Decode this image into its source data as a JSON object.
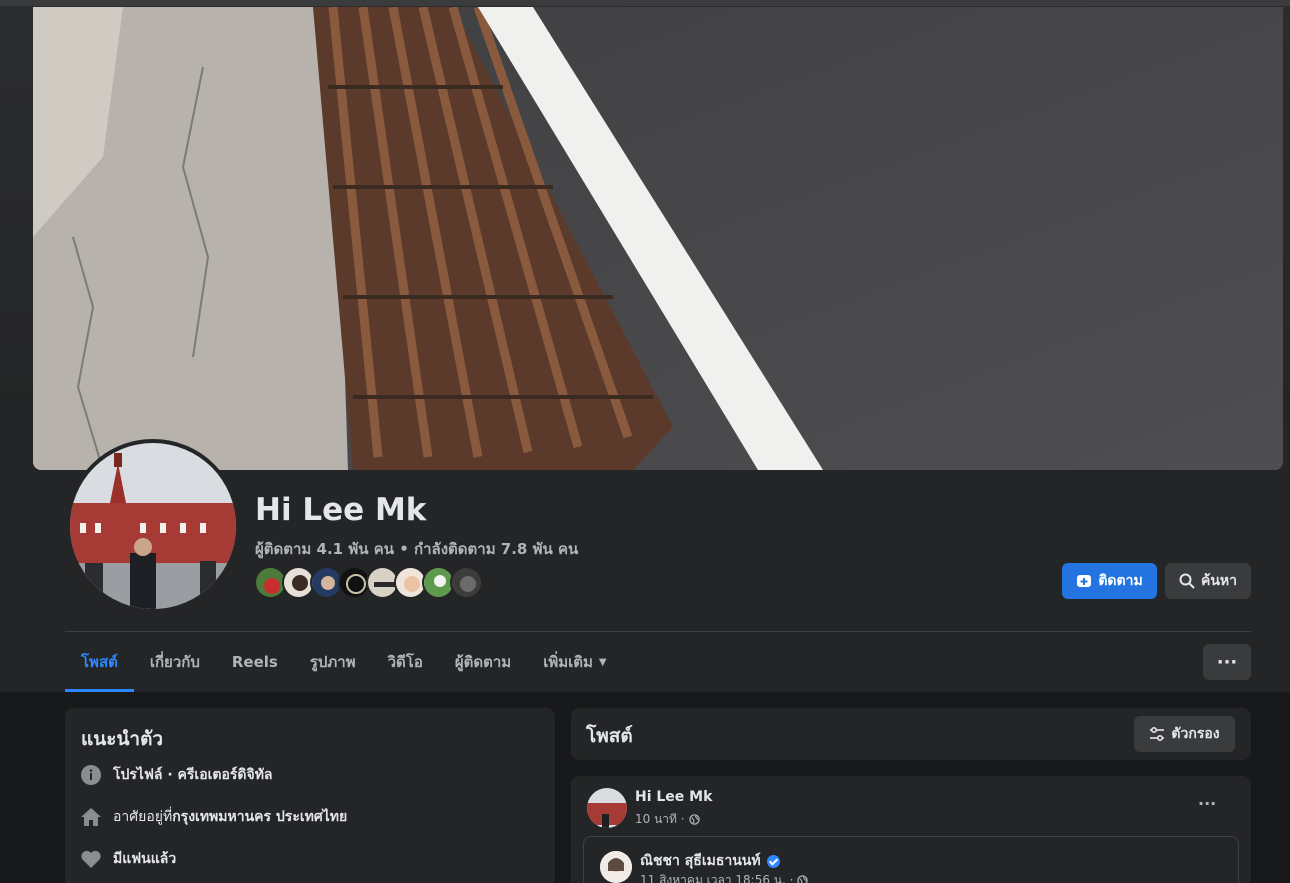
{
  "profile": {
    "name": "Hi Lee Mk",
    "stats": "ผู้ติดตาม 4.1 พัน คน • กำลังติดตาม 7.8 พัน คน"
  },
  "actions": {
    "follow_label": "ติดตาม",
    "search_label": "ค้นหา"
  },
  "tabs": [
    {
      "label": "โพสต์",
      "active": true
    },
    {
      "label": "เกี่ยวกับ"
    },
    {
      "label": "Reels"
    },
    {
      "label": "รูปภาพ"
    },
    {
      "label": "วิดีโอ"
    },
    {
      "label": "ผู้ติดตาม"
    },
    {
      "label": "เพิ่มเติม"
    }
  ],
  "more_label": "···",
  "intro": {
    "title": "แนะนำตัว",
    "rows": [
      {
        "icon": "info-icon",
        "prefix": "",
        "bold": "โปรไฟล์ · ครีเอเตอร์ดิจิทัล"
      },
      {
        "icon": "home-icon",
        "prefix": "อาศัยอยู่ที่ ",
        "bold": "กรุงเทพมหานคร ประเทศไทย"
      },
      {
        "icon": "heart-icon",
        "prefix": "",
        "bold": "มีแฟนแล้ว"
      }
    ]
  },
  "posts": {
    "title": "โพสต์",
    "filter_label": "ตัวกรอง"
  },
  "post": {
    "author": "Hi Lee Mk",
    "time": "10 นาที ·",
    "dots": "···",
    "shared_author": "ณิชชา สุธีเมธานนท์",
    "shared_time": "11 สิงหาคม เวลา 18:56 น. ·"
  },
  "colors": {
    "accent": "#2374e1",
    "active_tab": "#2d88ff",
    "background": "#18191a",
    "card": "#242526"
  }
}
